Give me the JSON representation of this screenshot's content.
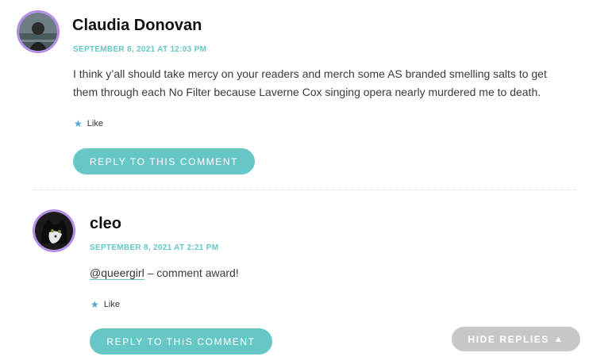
{
  "comments": [
    {
      "author": "Claudia Donovan",
      "date": "SEPTEMBER 8, 2021 AT 12:03 PM",
      "text_line1": "I think y’all should take mercy on your readers and merch some AS branded smelling salts to get",
      "text_line2": "them through each No Filter because Laverne Cox singing opera nearly murdered me to death.",
      "like_label": "Like",
      "reply_label": "REPLY TO THIS COMMENT"
    },
    {
      "author": "cleo",
      "date": "SEPTEMBER 8, 2021 AT 2:21 PM",
      "mention": "@queergirl",
      "text_rest": " – comment award!",
      "like_label": "Like",
      "reply_label": "REPLY TO THIS COMMENT"
    }
  ],
  "hide_replies": {
    "label": "HIDE REPLIES",
    "arrow": "▲"
  },
  "icons": {
    "like": "star-icon",
    "hide": "triangle-up-icon"
  },
  "colors": {
    "accent": "#67c7c6",
    "avatar_border": "#b48ee8",
    "like_star": "#4fa6d8",
    "hide_button": "#c7c7c7"
  }
}
